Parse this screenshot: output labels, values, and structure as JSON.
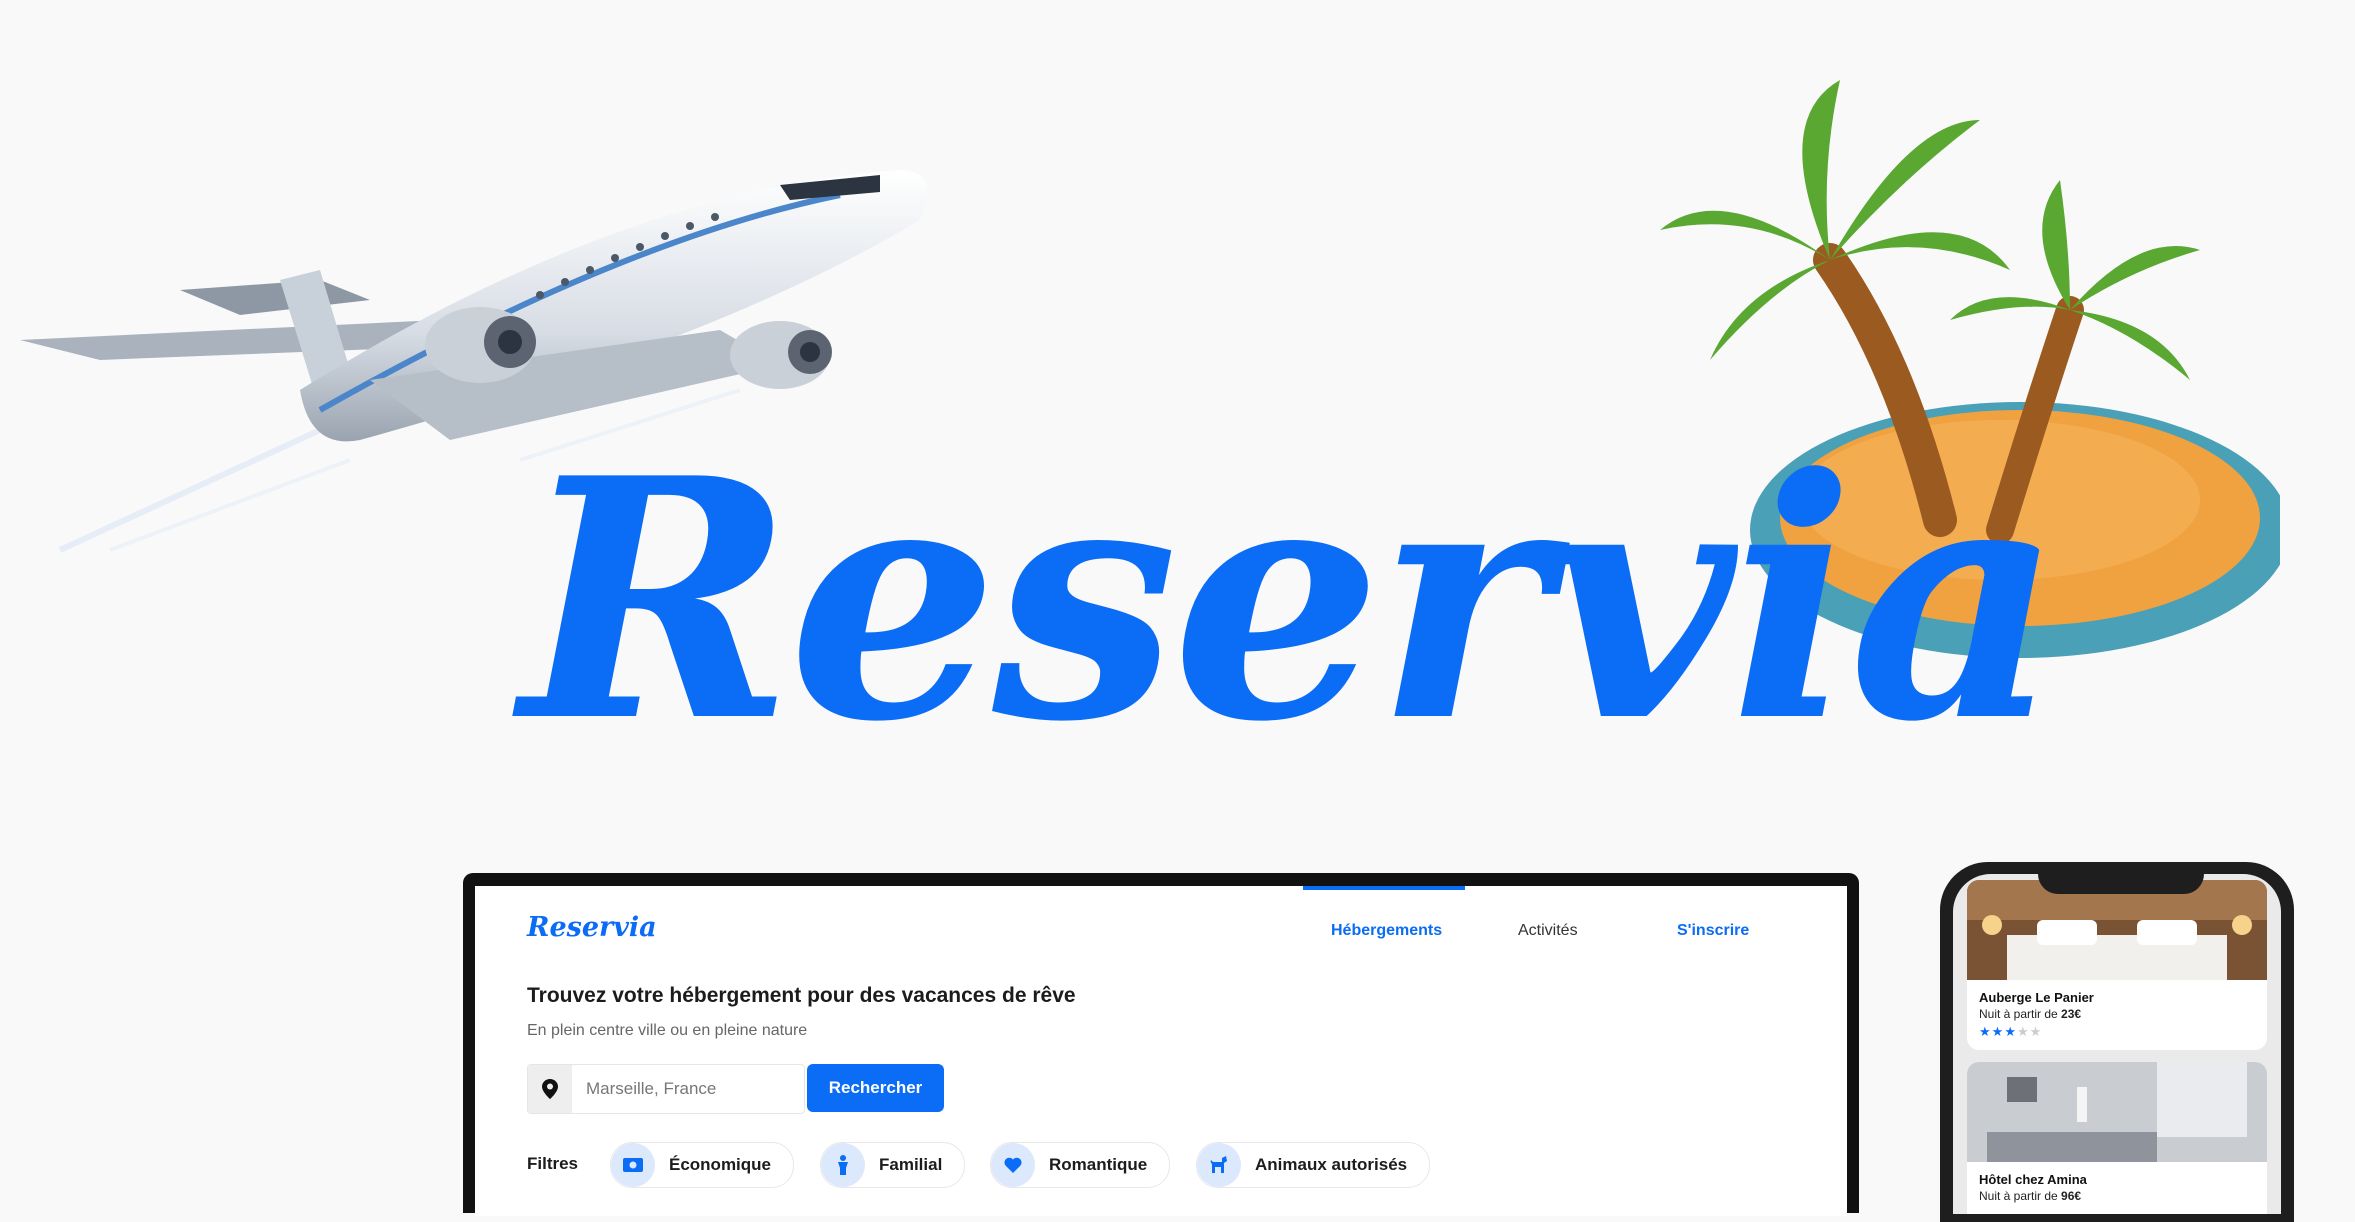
{
  "brand": {
    "hero_logo": "Reservia",
    "color": "#0b6cf5"
  },
  "screen": {
    "logo": "Reservia",
    "nav": {
      "accommodations": "Hébergements",
      "activities": "Activités",
      "signup": "S'inscrire"
    },
    "headline": "Trouvez votre hébergement pour des vacances de rêve",
    "subline": "En plein centre ville ou en pleine nature",
    "search": {
      "value": "Marseille, France",
      "button": "Rechercher"
    },
    "filters": {
      "label": "Filtres",
      "items": [
        {
          "label": "Économique",
          "icon": "money-icon"
        },
        {
          "label": "Familial",
          "icon": "person-icon"
        },
        {
          "label": "Romantique",
          "icon": "heart-icon"
        },
        {
          "label": "Animaux autorisés",
          "icon": "dog-icon"
        }
      ]
    }
  },
  "phone": {
    "cards": [
      {
        "title": "Auberge Le Panier",
        "price_prefix": "Nuit à partir de ",
        "price": "23€",
        "rating": 3,
        "max": 5
      },
      {
        "title": "Hôtel chez Amina",
        "price_prefix": "Nuit à partir de ",
        "price": "96€"
      }
    ]
  }
}
